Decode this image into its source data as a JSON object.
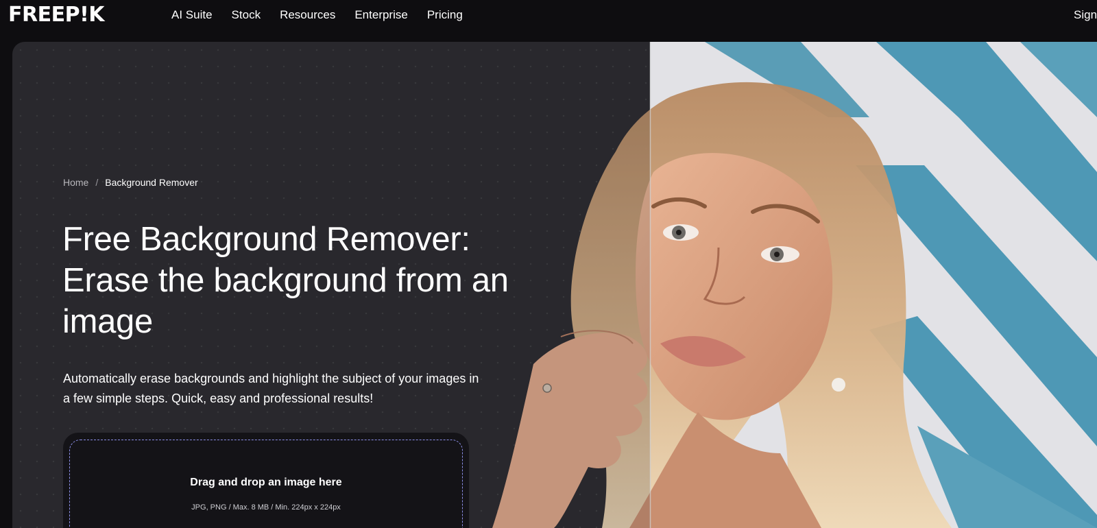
{
  "nav": {
    "logo": "FREEP!K",
    "links": [
      "AI Suite",
      "Stock",
      "Resources",
      "Enterprise",
      "Pricing"
    ],
    "signin": "Sign"
  },
  "breadcrumb": {
    "home": "Home",
    "separator": "/",
    "current": "Background Remover"
  },
  "hero": {
    "title": "Free Background Remover: Erase the background from an image",
    "subtitle": "Automatically erase backgrounds and highlight the subject of your images in a few simple steps. Quick, easy and professional results!"
  },
  "upload": {
    "title": "Drag and drop an image here",
    "hint": "JPG, PNG / Max. 8 MB / Min. 224px x 224px"
  },
  "colors": {
    "page_bg": "#0e0d10",
    "hero_bg": "#2a292d",
    "upload_border": "#8c8fe8",
    "chevron_blue": "#4b9bba"
  },
  "image": {
    "description_icon": "woman-portrait-before-after"
  }
}
